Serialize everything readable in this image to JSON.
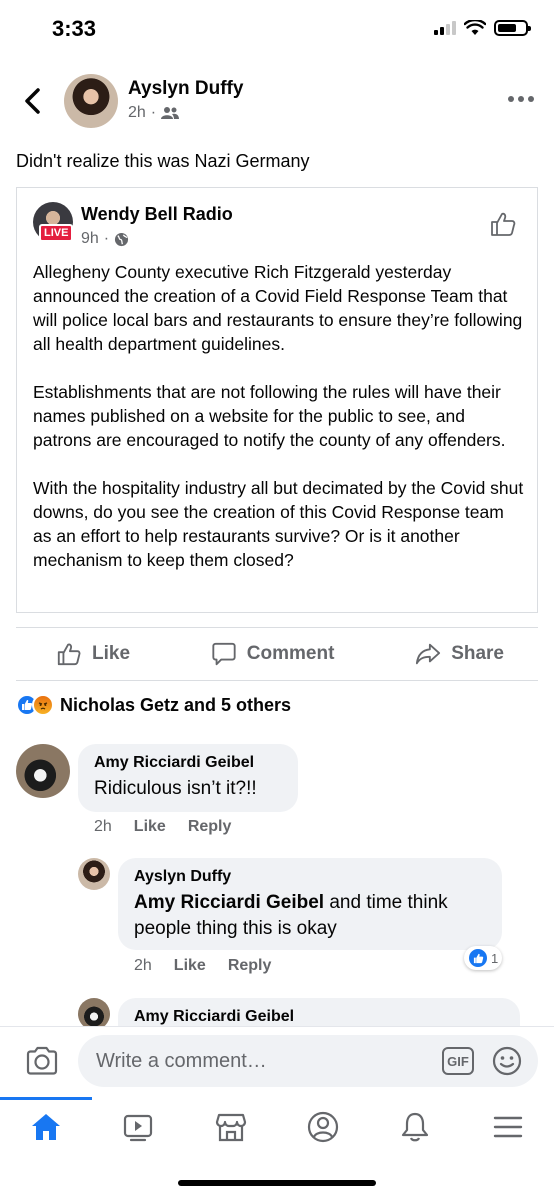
{
  "status": {
    "time": "3:33"
  },
  "post": {
    "author": "Ayslyn Duffy",
    "time": "2h",
    "text": "Didn't realize this was Nazi Germany"
  },
  "shared": {
    "page": "Wendy Bell Radio",
    "badge": "LIVE",
    "time": "9h",
    "paragraphs": [
      "Allegheny County executive Rich Fitzgerald yesterday announced the creation of a Covid Field Response Team that will police local bars and restaurants to ensure they’re following all health department guidelines.",
      "Establishments that are not following the rules will have their names published on a website for the public to see, and patrons are encouraged to notify the county of any offenders.",
      "With the hospitality industry all but decimated by the Covid shut downs, do you see the creation of this Covid Response team as an effort to help restaurants survive? Or is it another mechanism to keep them closed?"
    ]
  },
  "actions": {
    "like": "Like",
    "comment": "Comment",
    "share": "Share"
  },
  "reactions": {
    "summary": "Nicholas Getz and 5 others"
  },
  "comments": [
    {
      "name": "Amy Ricciardi Geibel",
      "text": "Ridiculous isn’t it?!!",
      "time": "2h",
      "like": "Like",
      "reply": "Reply"
    },
    {
      "name": "Ayslyn Duffy",
      "mention": "Amy Ricciardi Geibel",
      "text": " and time think people thing this is okay",
      "time": "2h",
      "like": "Like",
      "reply": "Reply",
      "reaction_count": "1"
    },
    {
      "name": "Amy Ricciardi Geibel"
    }
  ],
  "composer": {
    "placeholder": "Write a comment…",
    "gif": "GIF"
  },
  "colors": {
    "accent": "#1877f2",
    "secondary_text": "#65676b",
    "bubble": "#f0f2f5",
    "live": "#e41e3f"
  },
  "icons": [
    "back-icon",
    "friends-icon",
    "more-icon",
    "globe-icon",
    "thumbs-up-icon",
    "comment-icon",
    "share-icon",
    "camera-icon",
    "gif-icon",
    "emoji-icon",
    "home-icon",
    "watch-icon",
    "marketplace-icon",
    "profile-icon",
    "bell-icon",
    "menu-icon"
  ]
}
